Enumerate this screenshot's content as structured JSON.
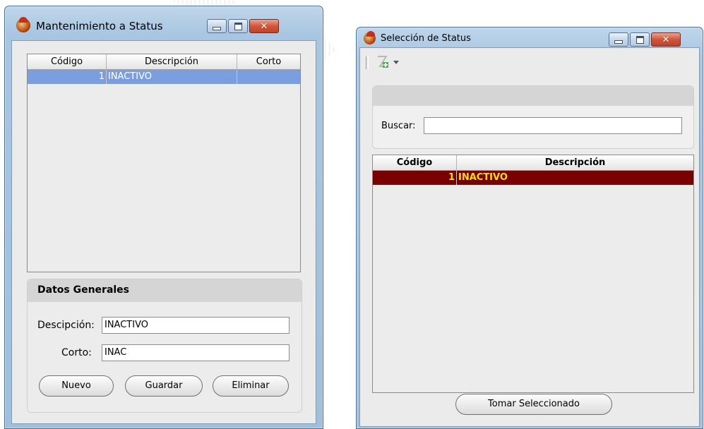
{
  "window_left": {
    "title": "Mantenimiento a Status",
    "grid": {
      "columns": [
        "Código",
        "Descripción",
        "Corto"
      ],
      "rows": [
        {
          "codigo": "1",
          "descripcion": "INACTIVO",
          "corto": ""
        }
      ]
    },
    "panel": {
      "title": "Datos Generales",
      "descripcion_label": "Descipción:",
      "descripcion_value": "INACTIVO",
      "corto_label": "Corto:",
      "corto_value": "INAC"
    },
    "buttons": {
      "nuevo": "Nuevo",
      "guardar": "Guardar",
      "eliminar": "Eliminar"
    }
  },
  "window_right": {
    "title": "Selección de Status",
    "toolbar": {
      "icons": [
        "grip-icon",
        "new-record-icon",
        "dropdown-arrow-icon"
      ]
    },
    "search": {
      "label": "Buscar:",
      "value": ""
    },
    "grid": {
      "columns": [
        "Código",
        "Descripción"
      ],
      "rows": [
        {
          "codigo": "1",
          "descripcion": "INACTIVO"
        }
      ]
    },
    "take_button": "Tomar Seleccionado"
  },
  "colors": {
    "selection_blue": "#7b9ee0",
    "selection_maroon": "#7a0000",
    "selection_text_yellow": "#ffe000",
    "close_red": "#d0563b"
  }
}
